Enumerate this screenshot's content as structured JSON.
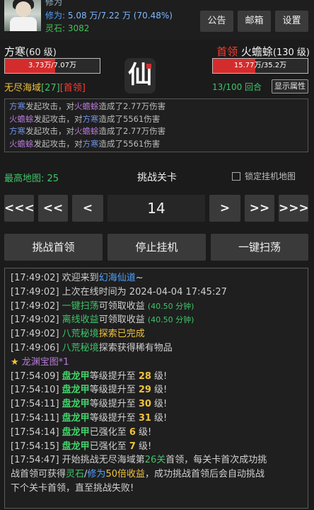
{
  "header": {
    "top_stub": "修为",
    "cultivation_label": "修为:",
    "cultivation_value": "5.08 万/7.22 万 (70.48%)",
    "stone_label": "灵石:",
    "stone_value": "3082",
    "buttons": [
      "公告",
      "邮箱",
      "设置"
    ]
  },
  "battle": {
    "player_name": "方寒",
    "player_level": "(60 级)",
    "player_hp_text": "3.73万/7.07万",
    "player_hp_fraction": 0.527,
    "boss_tag": "首领",
    "enemy_name": "火蟾蜍",
    "enemy_level": "(130 级)",
    "enemy_hp_text": "15.77万/35.2万",
    "enemy_hp_fraction": 0.448,
    "emblem_char": "仙",
    "region_name": "无尽海域",
    "region_stage": "[27]",
    "region_tag": "[首领]",
    "rounds": "13/100 回合",
    "show_attr_label": "显示属性",
    "combat_log": [
      {
        "a": "方寒",
        "ac": "player",
        "mid": "发起攻击，对",
        "t": "火蟾蜍",
        "tc": "enemy",
        "end": "造成了2.77万伤害"
      },
      {
        "a": "火蟾蜍",
        "ac": "enemy",
        "mid": "发起攻击，对",
        "t": "方寒",
        "tc": "player",
        "end": "造成了5561伤害"
      },
      {
        "a": "方寒",
        "ac": "player",
        "mid": "发起攻击，对",
        "t": "火蟾蜍",
        "tc": "enemy",
        "end": "造成了2.77万伤害"
      },
      {
        "a": "火蟾蜍",
        "ac": "enemy",
        "mid": "发起攻击，对",
        "t": "方寒",
        "tc": "player",
        "end": "造成了5561伤害"
      }
    ]
  },
  "stage": {
    "max_map_label": "最高地图: ",
    "max_map_value": "25",
    "title": "挑战关卡",
    "lock_label": "锁定挂机地图",
    "current": "14",
    "nav": [
      "<<<",
      "<<",
      "<",
      ">",
      ">>",
      ">>>"
    ],
    "actions": [
      "挑战首领",
      "停止挂机",
      "一键扫荡"
    ]
  },
  "system_log": [
    [
      {
        "t": "[17:49:02] ",
        "c": "ts"
      },
      {
        "t": "欢迎来到",
        "c": ""
      },
      {
        "t": "幻海仙道",
        "c": "b"
      },
      {
        "t": "~",
        "c": ""
      }
    ],
    [
      {
        "t": "[17:49:02] ",
        "c": "ts"
      },
      {
        "t": "上次在线时间为 2024-04-04 17:45:27",
        "c": ""
      }
    ],
    [
      {
        "t": "[17:49:02] ",
        "c": "ts"
      },
      {
        "t": "一键扫荡",
        "c": "g"
      },
      {
        "t": "可领取收益 ",
        "c": ""
      },
      {
        "t": "(40.50 分钟)",
        "c": "small-g"
      }
    ],
    [
      {
        "t": "[17:49:02] ",
        "c": "ts"
      },
      {
        "t": "离线收益",
        "c": "g"
      },
      {
        "t": "可领取收益 ",
        "c": ""
      },
      {
        "t": "(40.50 分钟)",
        "c": "small-g"
      }
    ],
    [
      {
        "t": "[17:49:02] ",
        "c": "ts"
      },
      {
        "t": "八荒秘境",
        "c": "g"
      },
      {
        "t": "探索已完成",
        "c": "y"
      }
    ],
    [
      {
        "t": "[17:49:06] ",
        "c": "ts"
      },
      {
        "t": "八荒秘境",
        "c": "g"
      },
      {
        "t": "探索获得稀有物品",
        "c": ""
      }
    ],
    [
      {
        "t": "★ ",
        "c": "star"
      },
      {
        "t": "龙渊宝图*1",
        "c": "m"
      }
    ],
    [
      {
        "t": "[17:54:09] ",
        "c": "ts"
      },
      {
        "t": "盘龙甲",
        "c": "gb"
      },
      {
        "t": "等级提升至 ",
        "c": ""
      },
      {
        "t": "28",
        "c": "yb"
      },
      {
        "t": " 级!",
        "c": ""
      }
    ],
    [
      {
        "t": "[17:54:10] ",
        "c": "ts"
      },
      {
        "t": "盘龙甲",
        "c": "gb"
      },
      {
        "t": "等级提升至 ",
        "c": ""
      },
      {
        "t": "29",
        "c": "yb"
      },
      {
        "t": " 级!",
        "c": ""
      }
    ],
    [
      {
        "t": "[17:54:11] ",
        "c": "ts"
      },
      {
        "t": "盘龙甲",
        "c": "gb"
      },
      {
        "t": "等级提升至 ",
        "c": ""
      },
      {
        "t": "30",
        "c": "yb"
      },
      {
        "t": " 级!",
        "c": ""
      }
    ],
    [
      {
        "t": "[17:54:11] ",
        "c": "ts"
      },
      {
        "t": "盘龙甲",
        "c": "gb"
      },
      {
        "t": "等级提升至 ",
        "c": ""
      },
      {
        "t": "31",
        "c": "yb"
      },
      {
        "t": " 级!",
        "c": ""
      }
    ],
    [
      {
        "t": "[17:54:14] ",
        "c": "ts"
      },
      {
        "t": "盘龙甲",
        "c": "gb"
      },
      {
        "t": "已强化至 ",
        "c": ""
      },
      {
        "t": "6",
        "c": "yb"
      },
      {
        "t": " 级!",
        "c": ""
      }
    ],
    [
      {
        "t": "[17:54:15] ",
        "c": "ts"
      },
      {
        "t": "盘龙甲",
        "c": "gb"
      },
      {
        "t": "已强化至 ",
        "c": ""
      },
      {
        "t": "7",
        "c": "yb"
      },
      {
        "t": " 级!",
        "c": ""
      }
    ],
    [
      {
        "t": "[17:54:47] ",
        "c": "ts"
      },
      {
        "t": "开始挑战",
        "c": ""
      },
      {
        "t": "无尽海域",
        "c": ""
      },
      {
        "t": "第",
        "c": ""
      },
      {
        "t": "26",
        "c": "g"
      },
      {
        "t": "关",
        "c": "g"
      },
      {
        "t": "首领，每关卡首次成功挑",
        "c": ""
      }
    ],
    [
      {
        "t": "战首领可获得",
        "c": ""
      },
      {
        "t": "灵石",
        "c": "g"
      },
      {
        "t": "/",
        "c": ""
      },
      {
        "t": "修为",
        "c": "b"
      },
      {
        "t": "50倍收益",
        "c": "y"
      },
      {
        "t": "，成功挑战首领后会自动挑战",
        "c": ""
      }
    ],
    [
      {
        "t": "下个关卡首领，直至挑战失败!",
        "c": ""
      }
    ]
  ]
}
